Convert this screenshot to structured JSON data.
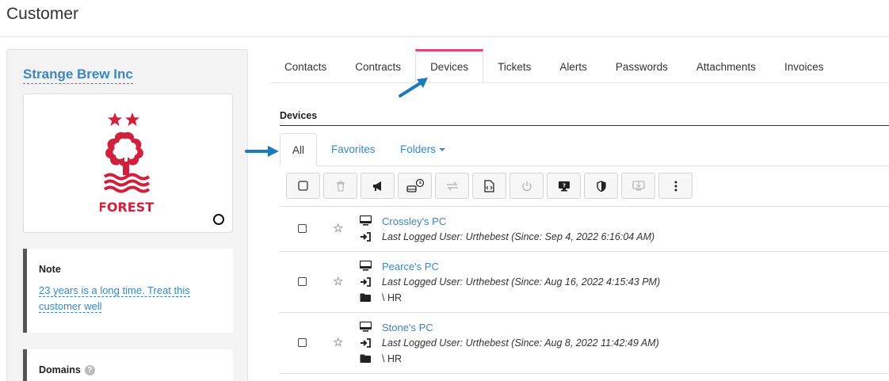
{
  "page": {
    "title": "Customer"
  },
  "customer": {
    "name": "Strange Brew Inc",
    "logo_text": "FOREST",
    "note": {
      "heading": "Note",
      "text": "23 years is a long time. Treat this customer well"
    },
    "domains": {
      "heading": "Domains",
      "help_icon": "?"
    }
  },
  "tabs": [
    {
      "label": "Contacts"
    },
    {
      "label": "Contracts"
    },
    {
      "label": "Devices"
    },
    {
      "label": "Tickets"
    },
    {
      "label": "Alerts"
    },
    {
      "label": "Passwords"
    },
    {
      "label": "Attachments"
    },
    {
      "label": "Invoices"
    }
  ],
  "devices": {
    "section_title": "Devices",
    "subtabs": {
      "all": "All",
      "favorites": "Favorites",
      "folders": "Folders"
    },
    "toolbar": [
      {
        "icon": "checkbox-icon"
      },
      {
        "icon": "trash-icon",
        "disabled": true
      },
      {
        "icon": "megaphone-icon"
      },
      {
        "icon": "scheduled-job-icon"
      },
      {
        "icon": "transfer-icon",
        "disabled": true
      },
      {
        "icon": "script-icon"
      },
      {
        "icon": "power-icon",
        "disabled": true
      },
      {
        "icon": "remote-screen-icon"
      },
      {
        "icon": "shield-icon"
      },
      {
        "icon": "install-icon",
        "disabled": true
      },
      {
        "icon": "more-icon"
      }
    ],
    "rows": [
      {
        "name": "Crossley's PC",
        "last_user": "Last Logged User: Urthebest (Since: Sep 4, 2022 6:16:04 AM)"
      },
      {
        "name": "Pearce's PC",
        "last_user": "Last Logged User: Urthebest (Since: Aug 16, 2022 4:15:43 PM)",
        "folder": "\\ HR"
      },
      {
        "name": "Stone's PC",
        "last_user": "Last Logged User: Urthebest (Since: Aug 8, 2022 11:42:49 AM)",
        "folder": "\\ HR"
      }
    ]
  },
  "colors": {
    "link": "#3a87c2",
    "active_tab": "#e0457b",
    "crest": "#d21f3c",
    "arrow": "#1f7ab8"
  }
}
